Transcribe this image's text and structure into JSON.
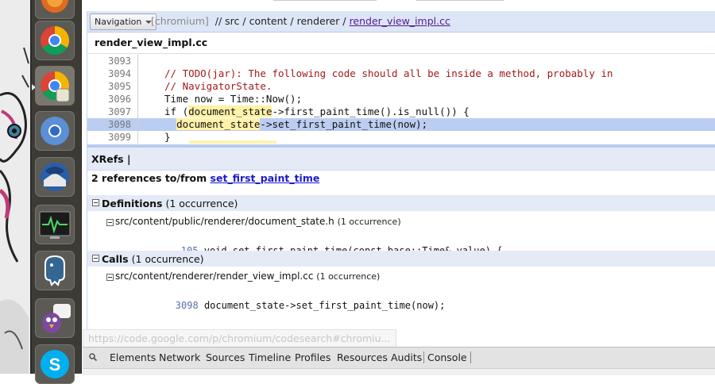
{
  "navigation": {
    "dropdown_label": "Navigation",
    "project": "[chromium]",
    "path": "// src / content / renderer /",
    "file_link": "render_view_impl.cc"
  },
  "file_header": "render_view_impl.cc",
  "code": {
    "lines": [
      {
        "num": "3093",
        "text": ""
      },
      {
        "num": "3094",
        "text": "// TODO(jar): The following code should all be inside a method, probably in",
        "comment": true
      },
      {
        "num": "3095",
        "text": "// NavigatorState.",
        "comment": true
      },
      {
        "num": "3096",
        "text": "Time now = Time::Now();"
      },
      {
        "num": "3097",
        "pre": "if (",
        "ref": "document_state",
        "post": "->first_paint_time().is_null()) {"
      },
      {
        "num": "3098",
        "pre": "  ",
        "ref": "document_state",
        "post": "->set_first_paint_time(now);",
        "highlight": true
      },
      {
        "num": "3099",
        "text": "}"
      }
    ]
  },
  "xrefs": {
    "title": "XRefs |",
    "summary_prefix": "2 references to/from",
    "symbol": "set_first_paint_time",
    "definitions": {
      "label": "Definitions",
      "count": "(1 occurrence)",
      "file": "src/content/public/renderer/document_state.h",
      "file_count": "(1 occurrence)",
      "line_num": "105",
      "line_text": "void set_first_paint_time(const base::Time& value) {"
    },
    "calls": {
      "label": "Calls",
      "count": "(1 occurrence)",
      "file": "src/content/renderer/render_view_impl.cc",
      "file_count": "(1 occurrence)",
      "line_num": "3098",
      "line_text": "document_state->set_first_paint_time(now);"
    }
  },
  "status_url": "https://code.google.com/p/chromium/codesearch#chromiu...",
  "devtools": {
    "tabs": [
      "Elements",
      "Network",
      "Sources",
      "Timeline",
      "Profiles",
      "Resources",
      "Audits",
      "Console"
    ],
    "selected": "Console"
  },
  "launcher": {
    "icons": [
      "firefox-icon",
      "chrome-icon",
      "chrome-icon",
      "chromium-icon",
      "thunderbird-icon",
      "system-monitor-icon",
      "postgresql-icon",
      "pidgin-icon",
      "skype-icon"
    ]
  },
  "colors": {
    "nav_bg": "#dde6f7",
    "highlight_line": "#bccdf2",
    "comment": "#a11a1a",
    "ref_highlight": "#fff1a8",
    "link": "#1a1acc"
  }
}
